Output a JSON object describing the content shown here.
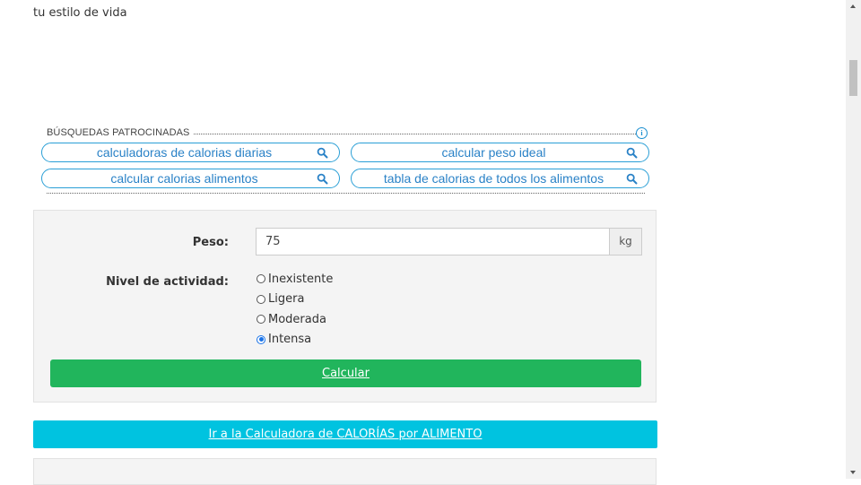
{
  "intro": {
    "text": "tu estilo de vida"
  },
  "sponsored": {
    "title": "BÚSQUEDAS PATROCINADAS",
    "info_symbol": "i",
    "items": [
      {
        "label": "calculadoras de calorias diarias"
      },
      {
        "label": "calcular peso ideal"
      },
      {
        "label": "calcular calorias alimentos"
      },
      {
        "label": "tabla de calorias de todos los alimentos"
      }
    ]
  },
  "form": {
    "weight_label": "Peso:",
    "weight_value": "75",
    "weight_unit": "kg",
    "activity_label": "Nivel de actividad:",
    "activity_options": [
      {
        "label": "Inexistente",
        "selected": false
      },
      {
        "label": "Ligera",
        "selected": false
      },
      {
        "label": "Moderada",
        "selected": false
      },
      {
        "label": "Intensa",
        "selected": true
      }
    ],
    "submit_label": "Calcular"
  },
  "food_link": {
    "label": "Ir a la Calculadora de CALORÍAS por ALIMENTO"
  },
  "colors": {
    "submit": "#21b55c",
    "link_banner": "#00c3e0",
    "pill_border": "#2a9fd6",
    "pill_text": "#2a82c7"
  }
}
